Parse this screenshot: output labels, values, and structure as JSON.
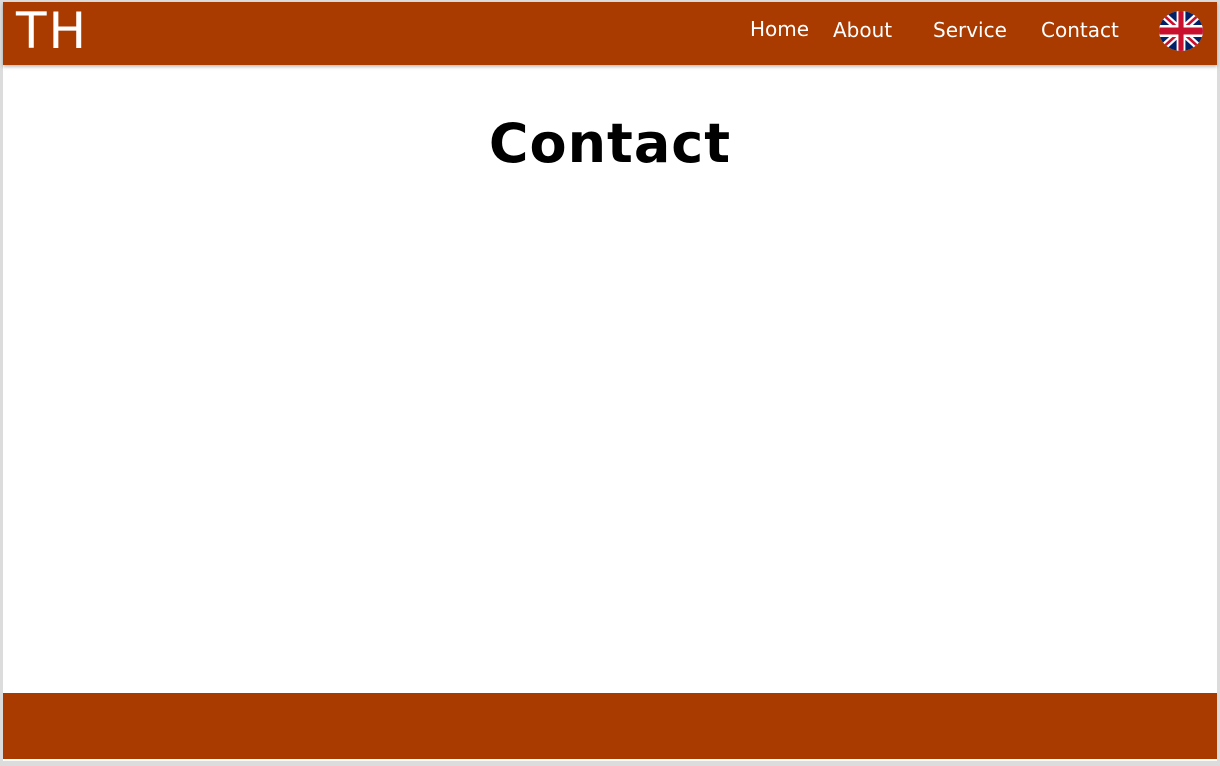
{
  "header": {
    "logo": "TH",
    "nav": {
      "home": "Home",
      "about": "About",
      "service": "Service",
      "contact": "Contact"
    },
    "language_icon": "uk-flag-icon"
  },
  "main": {
    "title": "Contact"
  },
  "colors": {
    "brand": "#a93a00",
    "background": "#ffffff",
    "text": "#000000"
  }
}
